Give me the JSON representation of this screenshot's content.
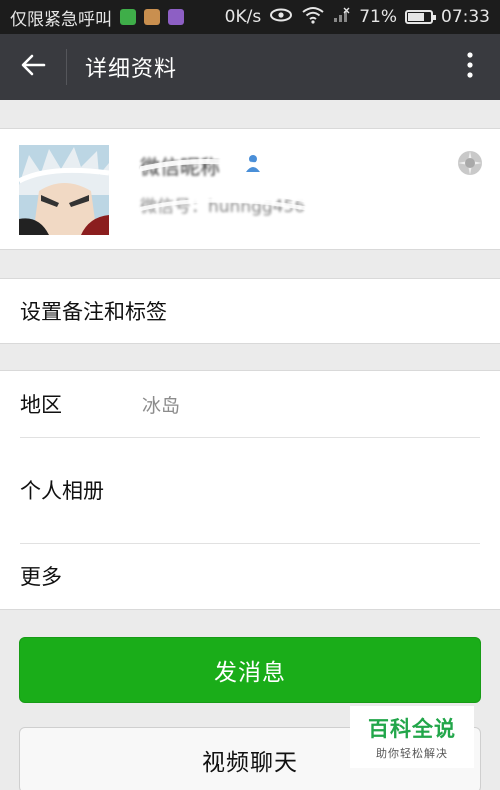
{
  "status_bar": {
    "carrier_text": "仅限紧急呼叫",
    "network_speed": "0K/s",
    "battery_percent": "71%",
    "battery_level": 0.71,
    "time": "07:33",
    "app_icon_colors": [
      "#3fae49",
      "#c98f4f",
      "#8d5fc4"
    ]
  },
  "title_bar": {
    "title": "详细资料",
    "back_icon": "arrow-left-icon",
    "more_icon": "more-vertical-icon"
  },
  "profile": {
    "nickname": "微信昵称",
    "wechat_id": "微信号：hunngg456",
    "gender_icon": "male-gender-icon",
    "gender_color": "#4a8fd8",
    "moments_icon": "camera-aperture-icon"
  },
  "rows": {
    "remark_tags": "设置备注和标签",
    "region_label": "地区",
    "region_value": "冰岛",
    "album": "个人相册",
    "more": "更多"
  },
  "buttons": {
    "send_message": "发消息",
    "video_chat": "视频聊天"
  },
  "watermark": {
    "title": "百科全说",
    "subtitle": "助你轻松解决"
  },
  "colors": {
    "accent_green": "#1aad19",
    "title_bar_bg": "#393a3f",
    "status_bar_bg": "#1c1c1c"
  }
}
